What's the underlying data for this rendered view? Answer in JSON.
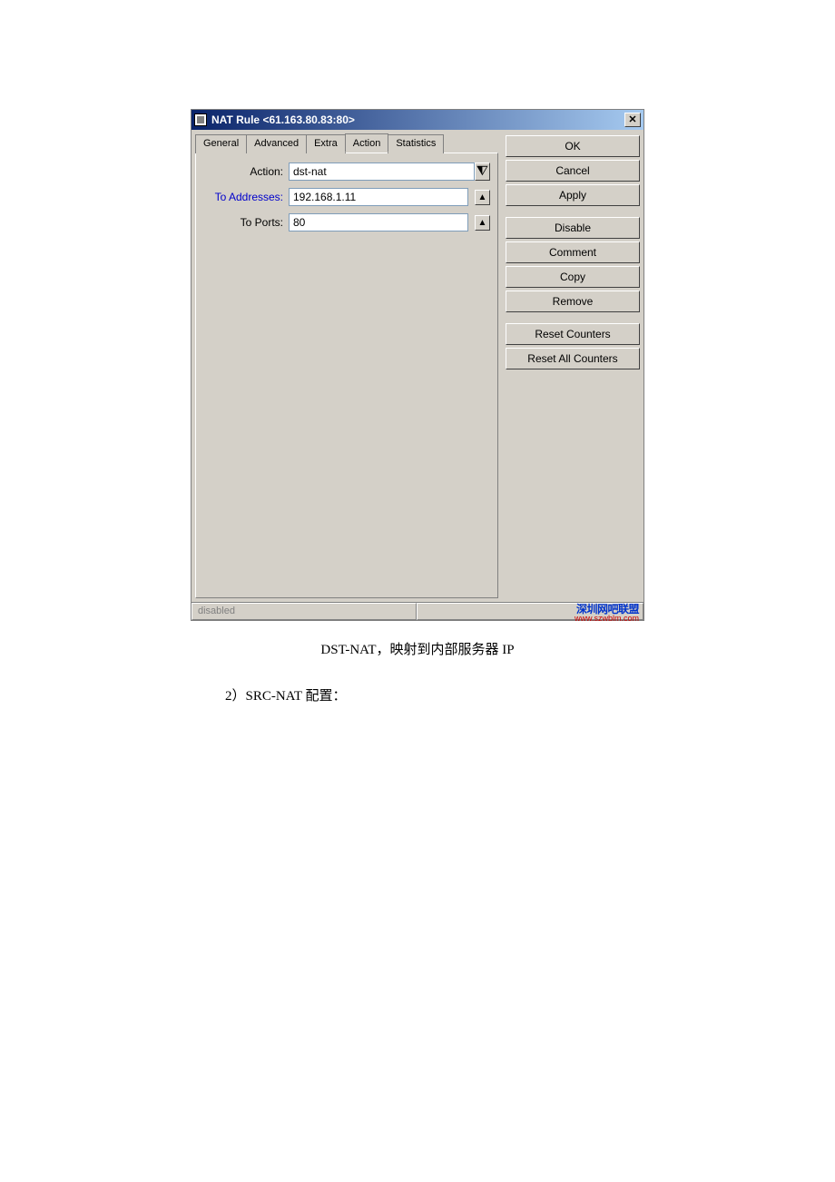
{
  "window": {
    "title": "NAT Rule <61.163.80.83:80>"
  },
  "tabs": {
    "general": "General",
    "advanced": "Advanced",
    "extra": "Extra",
    "action": "Action",
    "statistics": "Statistics"
  },
  "form": {
    "action_label": "Action:",
    "action_value": "dst-nat",
    "to_addr_label": "To Addresses:",
    "to_addr_value": "192.168.1.11",
    "to_ports_label": "To Ports:",
    "to_ports_value": "80"
  },
  "buttons": {
    "ok": "OK",
    "cancel": "Cancel",
    "apply": "Apply",
    "disable": "Disable",
    "comment": "Comment",
    "copy": "Copy",
    "remove": "Remove",
    "reset_counters": "Reset Counters",
    "reset_all_counters": "Reset All Counters"
  },
  "status": {
    "text": "disabled"
  },
  "watermark": {
    "line1": "深圳网吧联盟",
    "line2": "www.szwblm.com"
  },
  "caption": "DST-NAT，映射到内部服务器 IP",
  "subheading": "2）SRC-NAT 配置："
}
